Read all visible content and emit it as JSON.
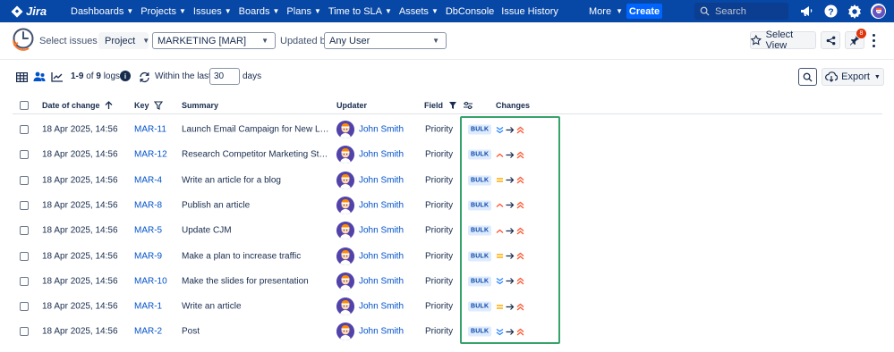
{
  "nav": {
    "logo": "Jira",
    "items": [
      "Dashboards",
      "Projects",
      "Issues",
      "Boards",
      "Plans",
      "Time to SLA",
      "Assets",
      "DbConsole",
      "Issue History"
    ],
    "items_with_chevron": [
      true,
      true,
      true,
      true,
      true,
      true,
      true,
      false,
      false
    ],
    "more": "More",
    "create": "Create",
    "search_placeholder": "Search",
    "notification_count": "8"
  },
  "filter": {
    "select_issues_by": "Select issues by:",
    "project_label": "Project",
    "project_value": "MARKETING [MAR]",
    "updated_by_label": "Updated by:",
    "updated_by_value": "Any User",
    "select_view": "Select View"
  },
  "toolbar": {
    "range_start": "1-9",
    "of_word": "of",
    "total": "9",
    "logs_word": "logs",
    "within_label": "Within the last:",
    "within_value": "30",
    "days_label": "days",
    "export": "Export"
  },
  "table": {
    "headers": {
      "date": "Date of change",
      "key": "Key",
      "summary": "Summary",
      "updater": "Updater",
      "field": "Field",
      "changes": "Changes"
    },
    "rows": [
      {
        "date": "18 Apr 2025, 14:56",
        "key": "MAR-11",
        "summary": "Launch Email Campaign for New Leads",
        "updater": "John Smith",
        "field": "Priority",
        "badge": "BULK",
        "from": "lowest",
        "to": "highest"
      },
      {
        "date": "18 Apr 2025, 14:56",
        "key": "MAR-12",
        "summary": "Research Competitor Marketing Strategies",
        "updater": "John Smith",
        "field": "Priority",
        "badge": "BULK",
        "from": "high",
        "to": "highest"
      },
      {
        "date": "18 Apr 2025, 14:56",
        "key": "MAR-4",
        "summary": "Write an article for a blog",
        "updater": "John Smith",
        "field": "Priority",
        "badge": "BULK",
        "from": "medium",
        "to": "highest"
      },
      {
        "date": "18 Apr 2025, 14:56",
        "key": "MAR-8",
        "summary": "Publish an article",
        "updater": "John Smith",
        "field": "Priority",
        "badge": "BULK",
        "from": "high",
        "to": "highest"
      },
      {
        "date": "18 Apr 2025, 14:56",
        "key": "MAR-5",
        "summary": "Update CJM",
        "updater": "John Smith",
        "field": "Priority",
        "badge": "BULK",
        "from": "high",
        "to": "highest"
      },
      {
        "date": "18 Apr 2025, 14:56",
        "key": "MAR-9",
        "summary": "Make a plan to increase traffic",
        "updater": "John Smith",
        "field": "Priority",
        "badge": "BULK",
        "from": "medium",
        "to": "highest"
      },
      {
        "date": "18 Apr 2025, 14:56",
        "key": "MAR-10",
        "summary": "Make the slides for presentation",
        "updater": "John Smith",
        "field": "Priority",
        "badge": "BULK",
        "from": "lowest",
        "to": "highest"
      },
      {
        "date": "18 Apr 2025, 14:56",
        "key": "MAR-1",
        "summary": "Write an article",
        "updater": "John Smith",
        "field": "Priority",
        "badge": "BULK",
        "from": "medium",
        "to": "highest"
      },
      {
        "date": "18 Apr 2025, 14:56",
        "key": "MAR-2",
        "summary": "Post",
        "updater": "John Smith",
        "field": "Priority",
        "badge": "BULK",
        "from": "lowest",
        "to": "highest"
      }
    ]
  },
  "colors": {
    "nav_bg": "#0747a6",
    "link": "#0052cc",
    "highlight_border": "#36a36a",
    "priority_high": "#ff5630",
    "priority_medium": "#ffab00",
    "priority_low": "#2684ff"
  }
}
